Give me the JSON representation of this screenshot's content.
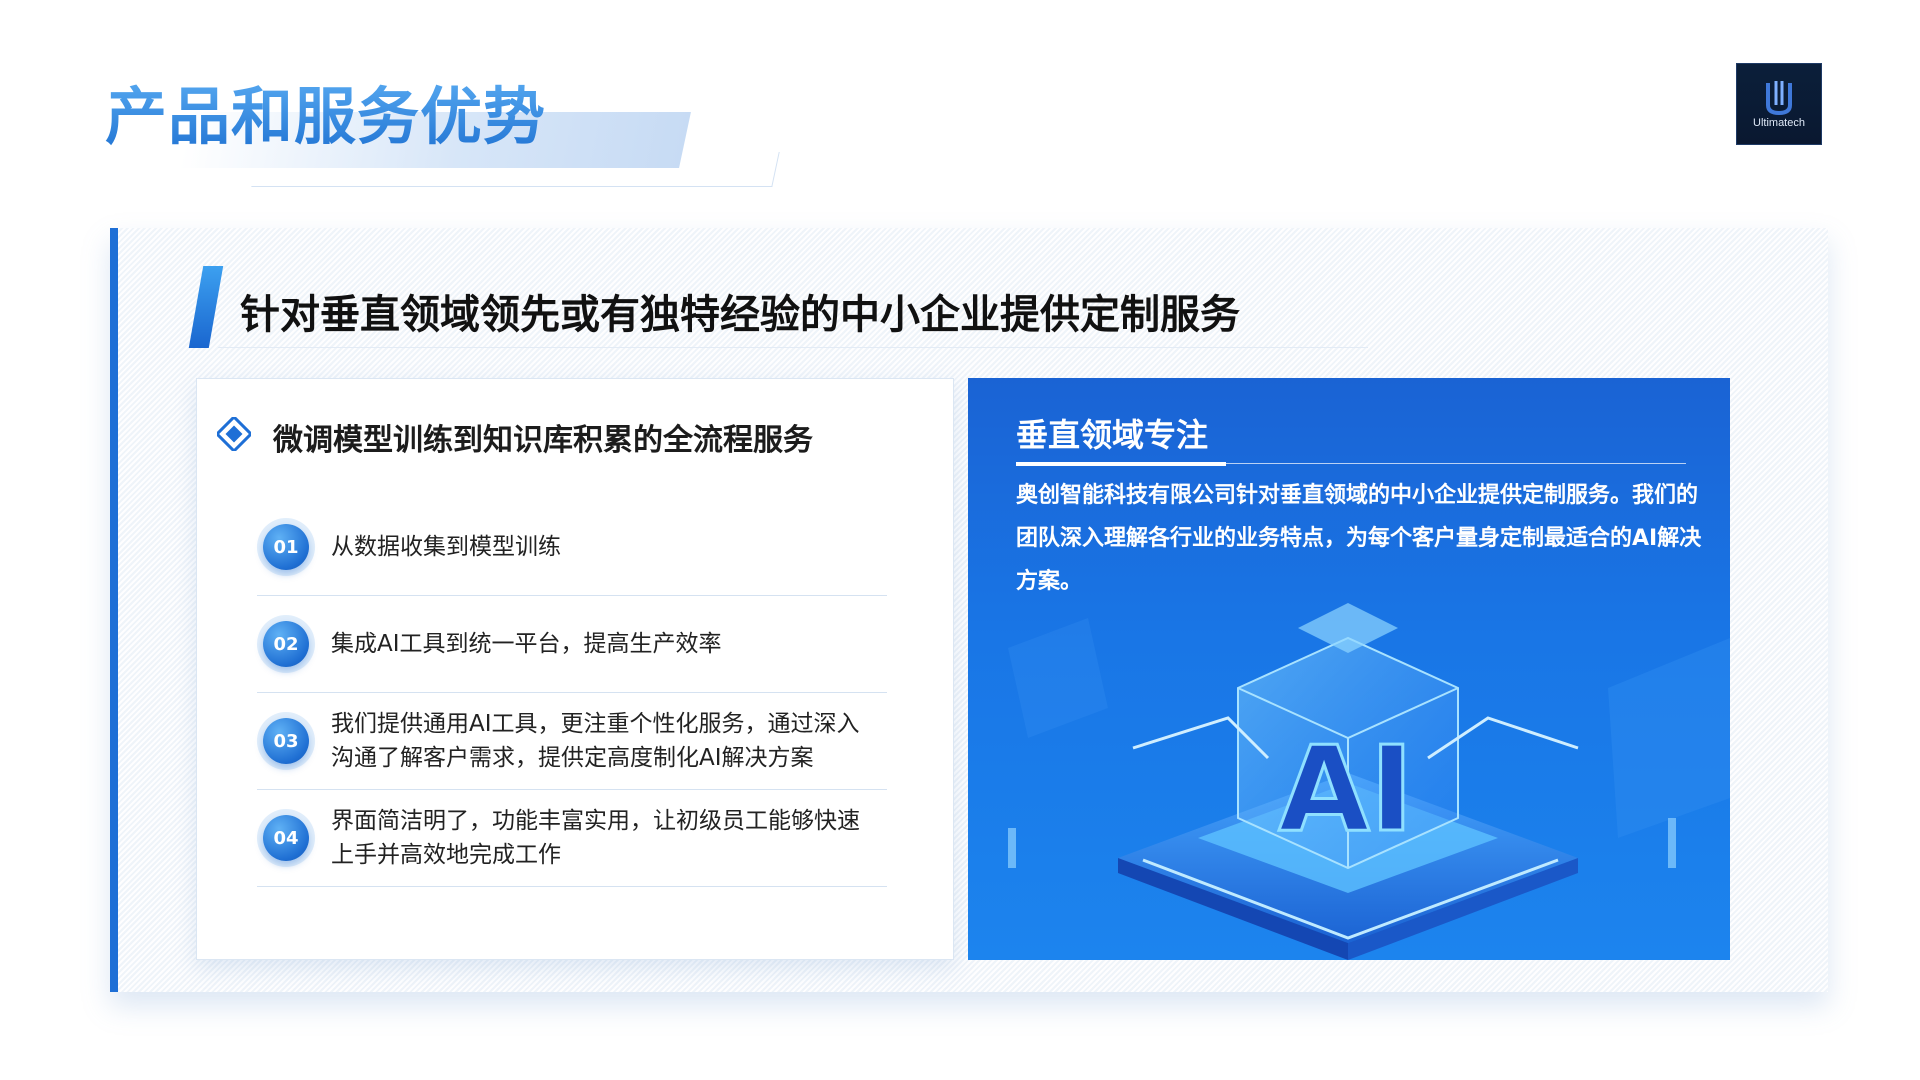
{
  "page_title": "产品和服务优势",
  "logo": {
    "text": "Ultimatech",
    "icon": "ultimatech-logo-icon"
  },
  "panel": {
    "heading": "针对垂直领域领先或有独特经验的中小企业提供定制服务",
    "left": {
      "icon": "diamond-icon",
      "heading": "微调模型训练到知识库积累的全流程服务",
      "steps": [
        {
          "num": "01",
          "text": "从数据收集到模型训练"
        },
        {
          "num": "02",
          "text": "集成AI工具到统一平台，提高生产效率"
        },
        {
          "num": "03",
          "text": "我们提供通用AI工具，更注重个性化服务，通过深入沟通了解客户需求，提供定高度制化AI解决方案"
        },
        {
          "num": "04",
          "text": "界面简洁明了，功能丰富实用，让初级员工能够快速上手并高效地完成工作"
        }
      ]
    },
    "right": {
      "heading": "垂直领域专注",
      "body": "奥创智能科技有限公司针对垂直领域的中小企业提供定制服务。我们的团队深入理解各行业的业务特点，为每个客户量身定制最适合的AI解决方案。",
      "art_label": "AI"
    }
  },
  "colors": {
    "accent": "#1e6fd6",
    "title_blue": "#2d8be0",
    "card_blue": "#1976e6"
  }
}
